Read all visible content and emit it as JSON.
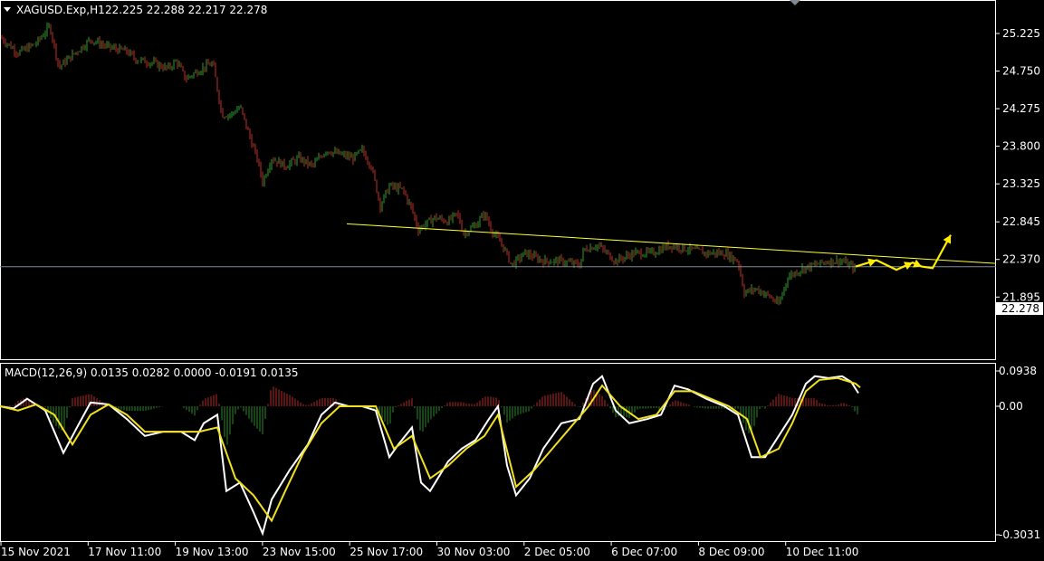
{
  "header": {
    "symbol": "XAGUSD.Exp,H1",
    "ohlc": "22.225 22.288 22.217 22.278"
  },
  "macd_header": "MACD(12,26,9) 0.0135 0.0282 0.0000 -0.0191 0.0135",
  "current_price_label": "22.278",
  "colors": {
    "background": "#000000",
    "bull": "#2e9e2e",
    "bear": "#c0302a",
    "trendline": "#ffff33",
    "arrows": "#ffee00",
    "macd_line": "#ffffff",
    "signal_line": "#f0e020",
    "hist_pos": "#b02a24",
    "hist_neg": "#2a8a2a",
    "grid_frame": "#ffffff"
  },
  "chart_data": [
    {
      "type": "candlestick",
      "symbol": "XAGUSD.Exp",
      "timeframe": "H1",
      "ylim": [
        21.62,
        25.65
      ],
      "price_ticks": [
        "25.225",
        "24.750",
        "24.275",
        "23.800",
        "23.325",
        "22.845",
        "22.370",
        "21.895"
      ],
      "current_price": 22.278,
      "time_ticks": [
        "15 Nov 2021",
        "17 Nov 11:00",
        "19 Nov 13:00",
        "23 Nov 15:00",
        "25 Nov 17:00",
        "30 Nov 03:00",
        "2 Dec 05:00",
        "6 Dec 07:00",
        "8 Dec 09:00",
        "10 Dec 11:00"
      ],
      "close_path": [
        [
          0,
          25.18
        ],
        [
          20,
          24.98
        ],
        [
          40,
          25.1
        ],
        [
          55,
          25.32
        ],
        [
          65,
          24.8
        ],
        [
          80,
          24.95
        ],
        [
          100,
          25.15
        ],
        [
          120,
          25.05
        ],
        [
          140,
          25.0
        ],
        [
          150,
          24.9
        ],
        [
          170,
          24.85
        ],
        [
          185,
          24.78
        ],
        [
          195,
          24.88
        ],
        [
          205,
          24.65
        ],
        [
          225,
          24.8
        ],
        [
          235,
          24.85
        ],
        [
          245,
          24.2
        ],
        [
          255,
          24.2
        ],
        [
          265,
          24.3
        ],
        [
          275,
          23.95
        ],
        [
          285,
          23.6
        ],
        [
          290,
          23.35
        ],
        [
          300,
          23.65
        ],
        [
          315,
          23.55
        ],
        [
          330,
          23.65
        ],
        [
          345,
          23.55
        ],
        [
          360,
          23.75
        ],
        [
          375,
          23.7
        ],
        [
          390,
          23.65
        ],
        [
          400,
          23.75
        ],
        [
          410,
          23.55
        ],
        [
          420,
          23.05
        ],
        [
          430,
          23.3
        ],
        [
          445,
          23.25
        ],
        [
          455,
          23.0
        ],
        [
          462,
          22.75
        ],
        [
          480,
          22.9
        ],
        [
          495,
          22.85
        ],
        [
          505,
          22.95
        ],
        [
          512,
          22.7
        ],
        [
          525,
          22.8
        ],
        [
          535,
          22.95
        ],
        [
          545,
          22.7
        ],
        [
          555,
          22.55
        ],
        [
          565,
          22.3
        ],
        [
          580,
          22.45
        ],
        [
          600,
          22.35
        ],
        [
          620,
          22.35
        ],
        [
          640,
          22.3
        ],
        [
          645,
          22.5
        ],
        [
          660,
          22.55
        ],
        [
          680,
          22.35
        ],
        [
          700,
          22.45
        ],
        [
          720,
          22.45
        ],
        [
          740,
          22.55
        ],
        [
          760,
          22.5
        ],
        [
          780,
          22.45
        ],
        [
          800,
          22.45
        ],
        [
          815,
          22.35
        ],
        [
          822,
          21.95
        ],
        [
          835,
          22.0
        ],
        [
          850,
          21.9
        ],
        [
          860,
          21.8
        ],
        [
          870,
          22.15
        ],
        [
          885,
          22.25
        ],
        [
          900,
          22.3
        ],
        [
          915,
          22.35
        ],
        [
          930,
          22.35
        ],
        [
          945,
          22.25
        ]
      ],
      "trendline": {
        "from": [
          383,
          22.82
        ],
        "to": [
          1100,
          22.32
        ]
      },
      "projection_arrows": [
        [
          945,
          22.28
        ],
        [
          968,
          22.36
        ],
        [
          990,
          22.24
        ],
        [
          1008,
          22.33
        ],
        [
          1018,
          22.28
        ],
        [
          1030,
          22.26
        ],
        [
          1050,
          22.68
        ]
      ]
    },
    {
      "type": "macd",
      "name": "MACD(12,26,9)",
      "ylim": [
        -0.3031,
        0.0938
      ],
      "y_ticks": [
        "0.0938",
        "0.00",
        "-0.3031"
      ],
      "values_printed": [
        0.0135,
        0.0282,
        0.0,
        -0.0191,
        0.0135
      ],
      "macd_path": [
        [
          0,
          0.0
        ],
        [
          15,
          -0.005
        ],
        [
          30,
          0.02
        ],
        [
          50,
          -0.01
        ],
        [
          70,
          -0.11
        ],
        [
          85,
          -0.05
        ],
        [
          100,
          0.01
        ],
        [
          120,
          0.005
        ],
        [
          140,
          -0.03
        ],
        [
          160,
          -0.07
        ],
        [
          180,
          -0.06
        ],
        [
          200,
          -0.06
        ],
        [
          215,
          -0.08
        ],
        [
          225,
          -0.04
        ],
        [
          240,
          -0.02
        ],
        [
          250,
          -0.2
        ],
        [
          265,
          -0.18
        ],
        [
          280,
          -0.25
        ],
        [
          290,
          -0.3
        ],
        [
          300,
          -0.22
        ],
        [
          320,
          -0.15
        ],
        [
          340,
          -0.09
        ],
        [
          355,
          -0.02
        ],
        [
          370,
          0.01
        ],
        [
          385,
          0.0
        ],
        [
          400,
          0.0
        ],
        [
          415,
          -0.01
        ],
        [
          430,
          -0.12
        ],
        [
          440,
          -0.09
        ],
        [
          455,
          -0.05
        ],
        [
          465,
          -0.18
        ],
        [
          475,
          -0.2
        ],
        [
          495,
          -0.13
        ],
        [
          510,
          -0.1
        ],
        [
          525,
          -0.08
        ],
        [
          540,
          -0.03
        ],
        [
          550,
          0.0
        ],
        [
          560,
          -0.14
        ],
        [
          570,
          -0.21
        ],
        [
          585,
          -0.17
        ],
        [
          600,
          -0.1
        ],
        [
          620,
          -0.04
        ],
        [
          640,
          -0.03
        ],
        [
          655,
          0.06
        ],
        [
          665,
          0.08
        ],
        [
          680,
          -0.01
        ],
        [
          695,
          -0.04
        ],
        [
          715,
          -0.03
        ],
        [
          730,
          -0.02
        ],
        [
          745,
          0.055
        ],
        [
          760,
          0.045
        ],
        [
          780,
          0.02
        ],
        [
          800,
          0.0
        ],
        [
          815,
          -0.02
        ],
        [
          830,
          -0.12
        ],
        [
          845,
          -0.12
        ],
        [
          860,
          -0.07
        ],
        [
          875,
          -0.02
        ],
        [
          890,
          0.06
        ],
        [
          900,
          0.08
        ],
        [
          915,
          0.075
        ],
        [
          930,
          0.08
        ],
        [
          940,
          0.065
        ],
        [
          948,
          0.035
        ]
      ],
      "signal_path": [
        [
          0,
          0.0
        ],
        [
          20,
          -0.01
        ],
        [
          40,
          0.005
        ],
        [
          60,
          -0.02
        ],
        [
          80,
          -0.09
        ],
        [
          100,
          -0.02
        ],
        [
          120,
          0.005
        ],
        [
          140,
          -0.02
        ],
        [
          160,
          -0.06
        ],
        [
          180,
          -0.06
        ],
        [
          200,
          -0.06
        ],
        [
          220,
          -0.06
        ],
        [
          240,
          -0.05
        ],
        [
          260,
          -0.17
        ],
        [
          280,
          -0.21
        ],
        [
          300,
          -0.27
        ],
        [
          315,
          -0.2
        ],
        [
          335,
          -0.11
        ],
        [
          355,
          -0.04
        ],
        [
          375,
          0.0
        ],
        [
          395,
          0.0
        ],
        [
          415,
          0.0
        ],
        [
          435,
          -0.1
        ],
        [
          455,
          -0.07
        ],
        [
          475,
          -0.17
        ],
        [
          495,
          -0.14
        ],
        [
          515,
          -0.1
        ],
        [
          535,
          -0.07
        ],
        [
          550,
          -0.02
        ],
        [
          570,
          -0.19
        ],
        [
          590,
          -0.15
        ],
        [
          610,
          -0.1
        ],
        [
          630,
          -0.05
        ],
        [
          650,
          0.0
        ],
        [
          665,
          0.055
        ],
        [
          685,
          0.0
        ],
        [
          705,
          -0.03
        ],
        [
          725,
          -0.02
        ],
        [
          745,
          0.04
        ],
        [
          765,
          0.04
        ],
        [
          785,
          0.02
        ],
        [
          805,
          0.0
        ],
        [
          825,
          -0.03
        ],
        [
          840,
          -0.12
        ],
        [
          860,
          -0.1
        ],
        [
          875,
          -0.04
        ],
        [
          890,
          0.04
        ],
        [
          905,
          0.07
        ],
        [
          925,
          0.075
        ],
        [
          945,
          0.06
        ],
        [
          950,
          0.05
        ]
      ]
    }
  ]
}
